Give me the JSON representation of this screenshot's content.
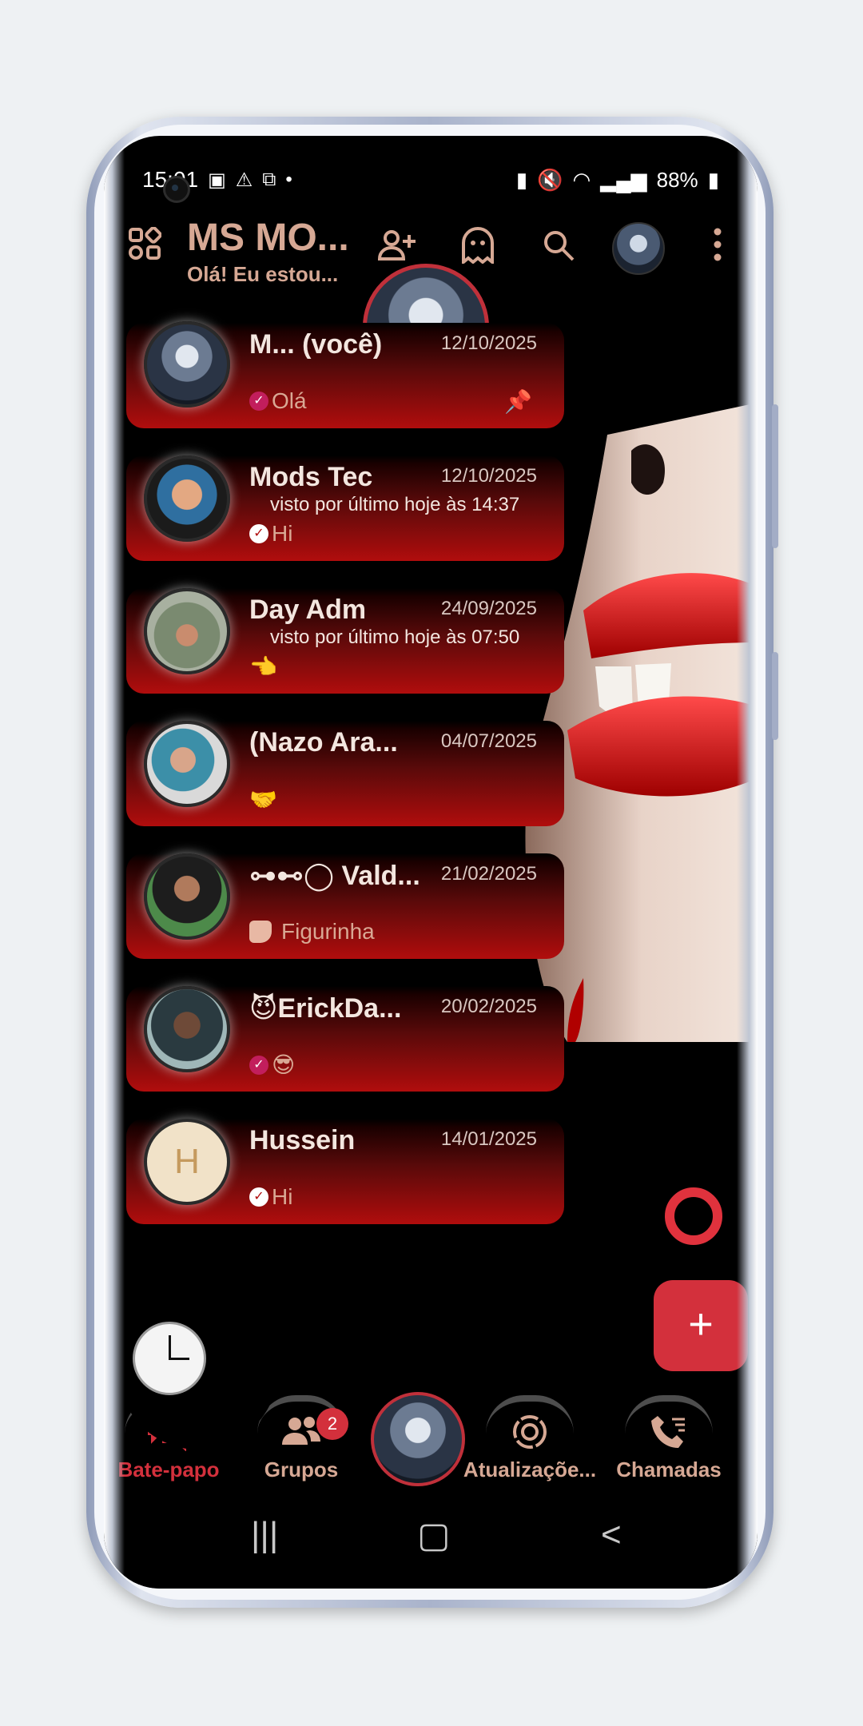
{
  "status_bar": {
    "time": "15:01",
    "battery": "88%"
  },
  "header": {
    "title": "MS MO...",
    "subtitle": "Olá! Eu estou..."
  },
  "chats": [
    {
      "name": "M... (você)",
      "date": "12/10/2025",
      "last_seen": "",
      "preview": "Olá",
      "pinned": true
    },
    {
      "name": "Mods Tec",
      "date": "12/10/2025",
      "last_seen": "visto por último hoje às 14:37",
      "preview": "Hi"
    },
    {
      "name": "Day Adm",
      "date": "24/09/2025",
      "last_seen": "visto por último hoje às 07:50",
      "preview": "👈"
    },
    {
      "name": "(Nazo Ara...",
      "date": "04/07/2025",
      "last_seen": "",
      "preview": "🤝"
    },
    {
      "name": "⊶⊷◯ Vald...",
      "date": "21/02/2025",
      "last_seen": "",
      "preview": "Figurinha"
    },
    {
      "name": "😈ErickDa...",
      "date": "20/02/2025",
      "last_seen": "",
      "preview": "😎"
    },
    {
      "name": "Hussein",
      "date": "14/01/2025",
      "last_seen": "",
      "preview": "Hi"
    }
  ],
  "fab_label": "+",
  "bottom_nav": {
    "chats": "Bate-papo",
    "groups": "Grupos",
    "groups_badge": "2",
    "updates": "Atualizaçõe...",
    "calls": "Chamadas"
  }
}
